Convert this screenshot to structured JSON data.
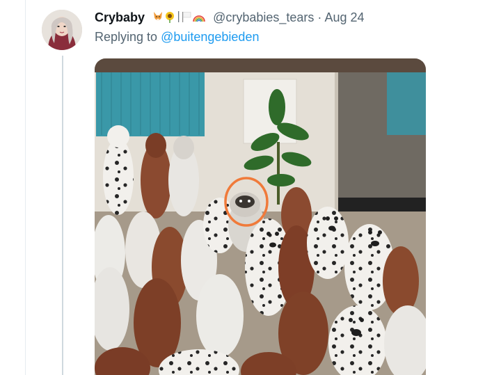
{
  "tweet": {
    "display_name": "Crybaby",
    "handle": "@crybabies_tears",
    "separator": "·",
    "date": "Aug 24",
    "replying_prefix": "Replying to",
    "replying_to": "@buitengebieden",
    "emoji_icons": [
      "fox-face-icon",
      "sunflower-icon",
      "vertical-bar-icon",
      "white-flag-icon",
      "rainbow-icon"
    ]
  },
  "media": {
    "subject": "dog-figurines-photo",
    "highlight_color": "#f07a3a"
  },
  "colors": {
    "text_primary": "#0f1419",
    "text_secondary": "#536471",
    "link": "#1d9bf0",
    "thread_line": "#cfd9de"
  }
}
